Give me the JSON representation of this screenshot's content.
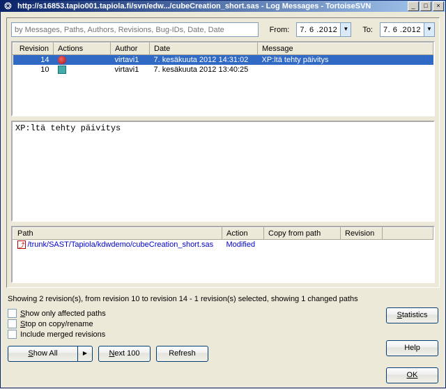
{
  "titlebar": {
    "text": "http://s16853.tapio001.tapiola.fi/svn/edw.../cubeCreation_short.sas - Log Messages - TortoiseSVN"
  },
  "filter": {
    "placeholder": "by Messages, Paths, Authors, Revisions, Bug-IDs, Date, Date",
    "from_label": "From:",
    "to_label": "To:",
    "from_value": "7. 6 .2012",
    "to_value": "7. 6 .2012"
  },
  "log_columns": {
    "revision": "Revision",
    "actions": "Actions",
    "author": "Author",
    "date": "Date",
    "message": "Message"
  },
  "log_rows": [
    {
      "revision": "14",
      "author": "virtavi1",
      "date": "7. kesäkuuta 2012 14:31:02",
      "message": "XP:ltä tehty päivitys",
      "selected": true
    },
    {
      "revision": "10",
      "author": "virtavi1",
      "date": "7. kesäkuuta 2012 13:40:25",
      "message": "",
      "selected": false
    }
  ],
  "message_text": "XP:ltä tehty päivitys",
  "paths_columns": {
    "path": "Path",
    "action": "Action",
    "copy_from": "Copy from path",
    "revision": "Revision"
  },
  "paths_rows": [
    {
      "path": "/trunk/SAST/Tapiola/kdwdemo/cubeCreation_short.sas",
      "action": "Modified"
    }
  ],
  "status": "Showing 2 revision(s), from revision 10 to revision 14 - 1 revision(s) selected, showing 1 changed paths",
  "checks": {
    "affected": "Show only affected paths",
    "stop": "Stop on copy/rename",
    "merged": "Include merged revisions"
  },
  "buttons": {
    "statistics": "Statistics",
    "help": "Help",
    "show_all": "Show All",
    "next_100": "Next 100",
    "refresh": "Refresh",
    "ok": "OK"
  }
}
